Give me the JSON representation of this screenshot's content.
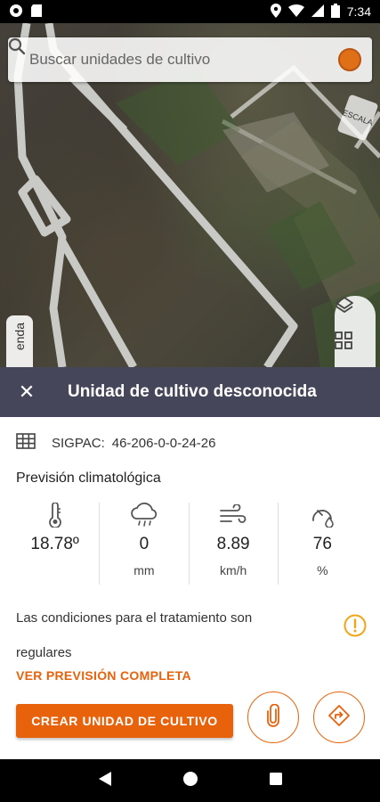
{
  "status_bar": {
    "time": "7:34",
    "left_icons": [
      "record-icon",
      "sd-card-icon"
    ],
    "right_icons": [
      "location-icon",
      "wifi-icon",
      "signal-icon",
      "battery-icon"
    ]
  },
  "search": {
    "placeholder": "Buscar unidades de cultivo"
  },
  "map": {
    "side_tab_label": "enda",
    "compass_label": "ESCALA"
  },
  "panel": {
    "title": "Unidad de cultivo desconocida",
    "sigpac_label": "SIGPAC:",
    "sigpac_value": "46-206-0-0-24-26",
    "forecast_title": "Previsión climatológica",
    "weather": [
      {
        "icon": "thermometer-icon",
        "value": "18.78º",
        "unit": ""
      },
      {
        "icon": "rain-cloud-icon",
        "value": "0",
        "unit": "mm"
      },
      {
        "icon": "wind-icon",
        "value": "8.89",
        "unit": "km/h"
      },
      {
        "icon": "humidity-gauge-icon",
        "value": "76",
        "unit": "%"
      }
    ],
    "condition_text": "Las condiciones para el tratamiento son regulares",
    "full_forecast_link": "VER PREVISIÓN COMPLETA",
    "create_button": "CREAR UNIDAD DE CULTIVO"
  },
  "colors": {
    "accent": "#e8620c",
    "header_bg": "#46465a",
    "warning": "#f2a516"
  }
}
